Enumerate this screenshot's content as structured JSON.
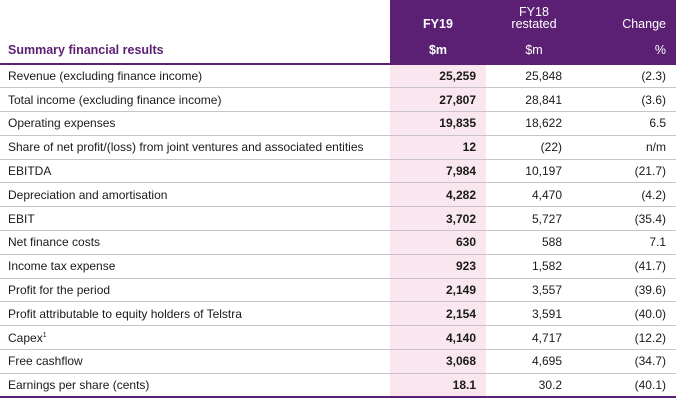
{
  "header": {
    "fy19_label": "FY19",
    "fy18_label_line1": "FY18",
    "fy18_label_line2": "restated",
    "change_label": "Change",
    "section_title": "Summary financial results",
    "unit_fy19": "$m",
    "unit_fy18": "$m",
    "unit_change": "%"
  },
  "rows": [
    {
      "label": "Revenue (excluding finance income)",
      "fy19": "25,259",
      "fy18": "25,848",
      "change": "(2.3)"
    },
    {
      "label": "Total income (excluding finance income)",
      "fy19": "27,807",
      "fy18": "28,841",
      "change": "(3.6)"
    },
    {
      "label": "Operating expenses",
      "fy19": "19,835",
      "fy18": "18,622",
      "change": "6.5"
    },
    {
      "label": "Share of net profit/(loss) from joint ventures and associated entities",
      "fy19": "12",
      "fy18": "(22)",
      "change": "n/m"
    },
    {
      "label": "EBITDA",
      "fy19": "7,984",
      "fy18": "10,197",
      "change": "(21.7)"
    },
    {
      "label": "Depreciation and amortisation",
      "fy19": "4,282",
      "fy18": "4,470",
      "change": "(4.2)"
    },
    {
      "label": "EBIT",
      "fy19": "3,702",
      "fy18": "5,727",
      "change": "(35.4)"
    },
    {
      "label": "Net finance costs",
      "fy19": "630",
      "fy18": "588",
      "change": "7.1"
    },
    {
      "label": "Income tax expense",
      "fy19": "923",
      "fy18": "1,582",
      "change": "(41.7)"
    },
    {
      "label": "Profit for the period",
      "fy19": "2,149",
      "fy18": "3,557",
      "change": "(39.6)"
    },
    {
      "label": "Profit attributable to equity holders of Telstra",
      "fy19": "2,154",
      "fy18": "3,591",
      "change": "(40.0)"
    },
    {
      "label": "Capex",
      "footnote": "1",
      "fy19": "4,140",
      "fy18": "4,717",
      "change": "(12.2)"
    },
    {
      "label": "Free cashflow",
      "fy19": "3,068",
      "fy18": "4,695",
      "change": "(34.7)"
    },
    {
      "label": "Earnings per share (cents)",
      "fy19": "18.1",
      "fy18": "30.2",
      "change": "(40.1)"
    }
  ]
}
